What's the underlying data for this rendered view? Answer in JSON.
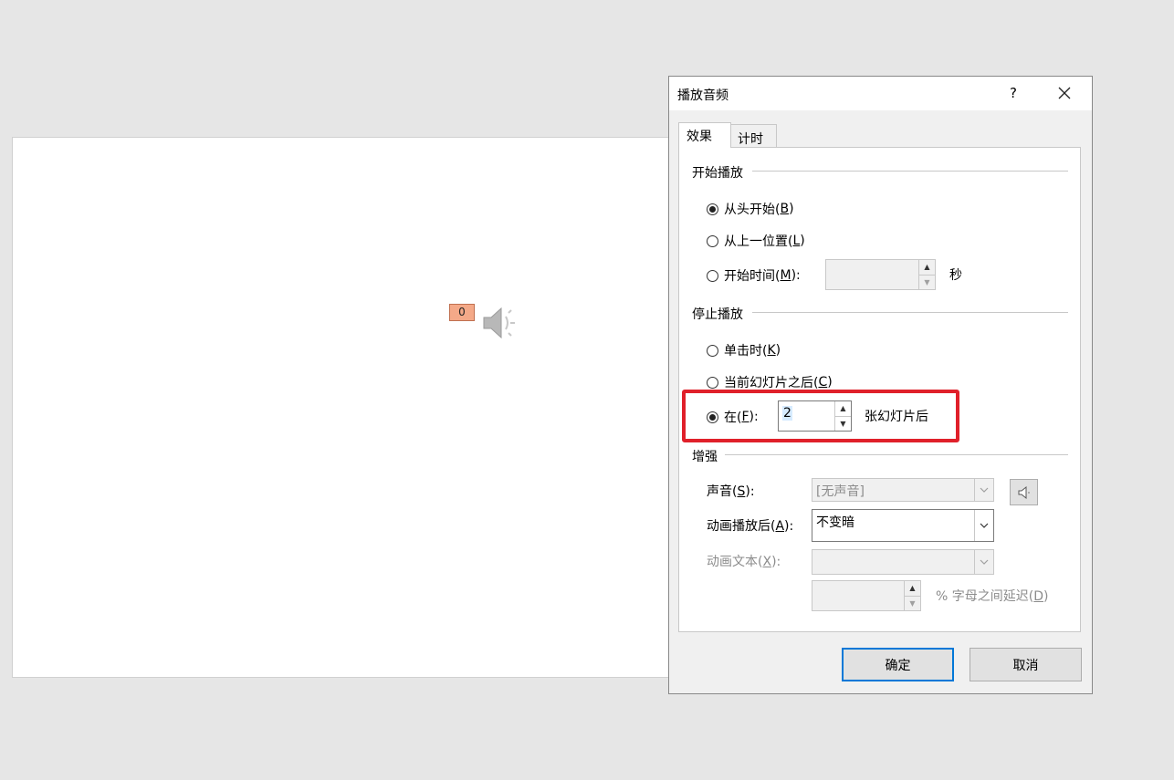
{
  "slide": {
    "animation_tag": "0",
    "audio_icon": "speaker-icon"
  },
  "dialog": {
    "title": "播放音频",
    "help_label": "?",
    "close_icon": "close-icon",
    "tabs": [
      {
        "label": "效果",
        "active": true
      },
      {
        "label": "计时",
        "active": false
      }
    ],
    "start_group": {
      "label": "开始播放",
      "options": [
        {
          "text": "从头开始(",
          "key": "B",
          "close": ")",
          "checked": true
        },
        {
          "text": "从上一位置(",
          "key": "L",
          "close": ")",
          "checked": false
        },
        {
          "text": "开始时间(",
          "key": "M",
          "close": "):",
          "checked": false
        }
      ],
      "time_value": "",
      "time_unit": "秒"
    },
    "stop_group": {
      "label": "停止播放",
      "options": [
        {
          "text": "单击时(",
          "key": "K",
          "close": ")",
          "checked": false
        },
        {
          "text": "当前幻灯片之后(",
          "key": "C",
          "close": ")",
          "checked": false
        },
        {
          "text": "在(",
          "key": "F",
          "close": "):",
          "checked": true
        }
      ],
      "after_value": "2",
      "after_suffix": "张幻灯片后"
    },
    "enhance_group": {
      "label": "增强",
      "sound_label": "声音(",
      "sound_key": "S",
      "sound_close": "):",
      "sound_value": "[无声音]",
      "after_anim_label": "动画播放后(",
      "after_anim_key": "A",
      "after_anim_close": "):",
      "after_anim_value": "不变暗",
      "anim_text_label": "动画文本(",
      "anim_text_key": "X",
      "anim_text_close": "):",
      "anim_text_value": "",
      "delay_value": "",
      "delay_label": "% 字母之间延迟(",
      "delay_key": "D",
      "delay_close": ")"
    },
    "buttons": {
      "ok": "确定",
      "cancel": "取消"
    }
  }
}
